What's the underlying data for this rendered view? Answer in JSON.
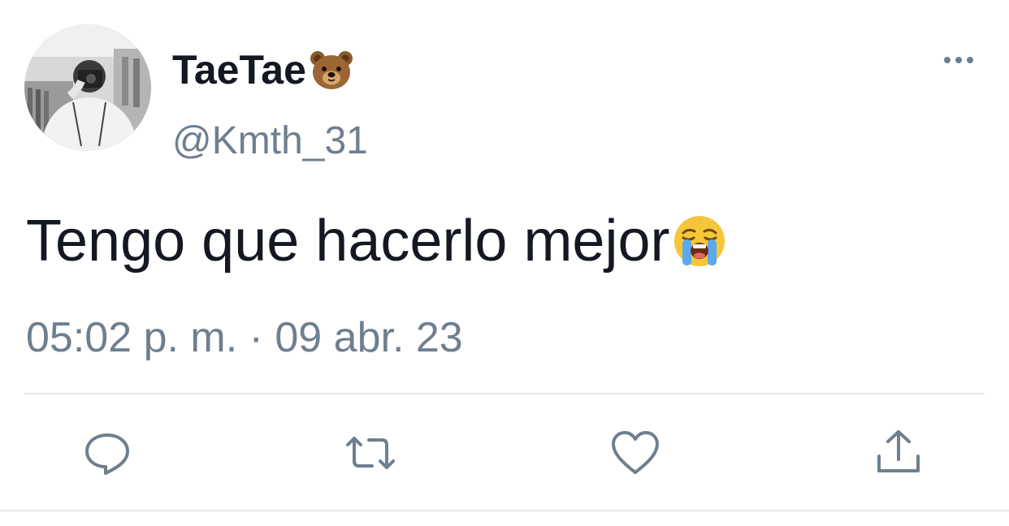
{
  "tweet": {
    "author": {
      "display_name": "TaeTae",
      "name_emoji": "bear-face",
      "handle": "@Kmth_31"
    },
    "text": "Tengo que hacerlo mejor",
    "text_emoji": "loudly-crying-face",
    "timestamp": "05:02 p. m. · 09 abr. 23"
  },
  "actions": [
    "reply-icon",
    "retweet-icon",
    "like-icon",
    "share-icon"
  ],
  "colors": {
    "text_primary": "#141823",
    "text_secondary": "#6e7f8f",
    "divider": "#e4e7ea"
  }
}
